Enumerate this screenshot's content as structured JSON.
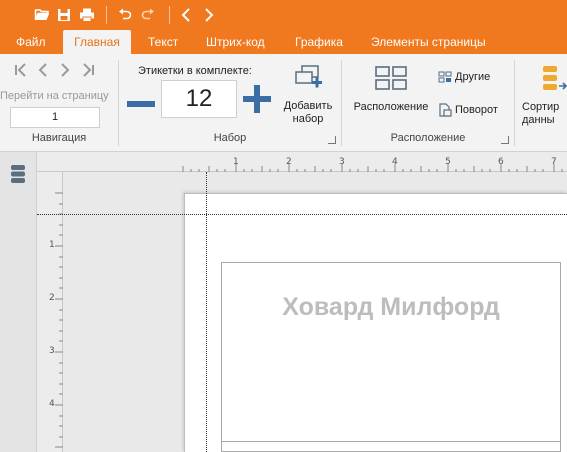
{
  "quick_access": {
    "icons": [
      "folder-open-icon",
      "save-icon",
      "print-icon",
      "undo-icon",
      "redo-icon",
      "prev-icon",
      "next-icon"
    ]
  },
  "tabs": [
    {
      "label": "Файл",
      "active": false
    },
    {
      "label": "Главная",
      "active": true
    },
    {
      "label": "Текст",
      "active": false
    },
    {
      "label": "Штрих-код",
      "active": false
    },
    {
      "label": "Графика",
      "active": false
    },
    {
      "label": "Элементы страницы",
      "active": false
    }
  ],
  "ribbon": {
    "navigation": {
      "goto_label": "Перейти на страницу",
      "page_value": "1",
      "group_label": "Навигация"
    },
    "kit": {
      "label": "Этикетки в комплекте:",
      "value": "12",
      "add_label": "Добавить набор",
      "group_label": "Набор"
    },
    "layout": {
      "layout_label": "Расположение",
      "other_label": "Другие",
      "rotate_label": "Поворот",
      "group_label": "Расположение"
    },
    "sort": {
      "label": "Сортир данны"
    }
  },
  "ruler": {
    "top_numbers": [
      "1",
      "2",
      "3",
      "4",
      "5",
      "6",
      "7"
    ],
    "left_numbers": [
      "1",
      "2",
      "3",
      "4"
    ]
  },
  "label": {
    "name": "Ховард Милфорд"
  },
  "colors": {
    "accent": "#f0781e",
    "ribbon_bg": "#f3f3f3",
    "icon_blue": "#3a6ea5",
    "icon_gray": "#5a6e80"
  }
}
